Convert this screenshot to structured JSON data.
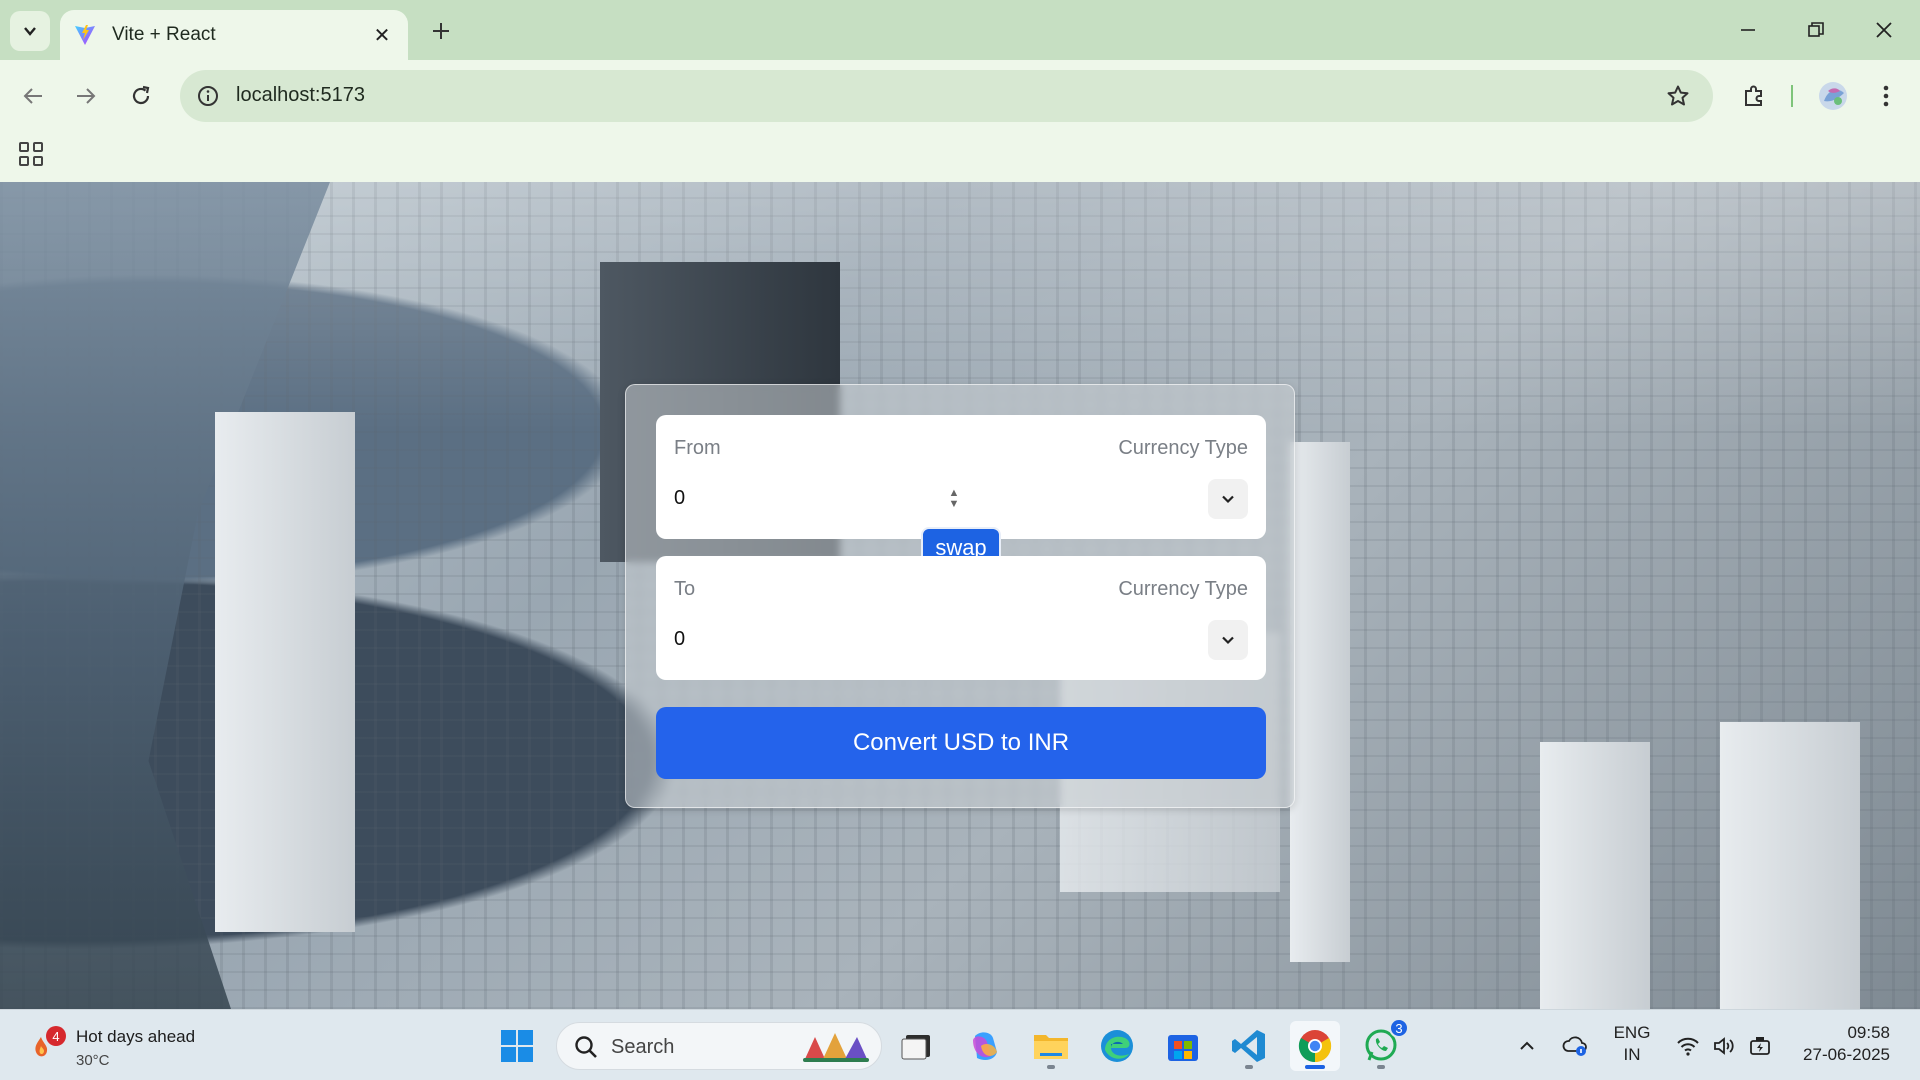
{
  "browser": {
    "tab_title": "Vite + React",
    "url": "localhost:5173"
  },
  "converter": {
    "from": {
      "label": "From",
      "currency_type_label": "Currency Type",
      "amount": "0"
    },
    "to": {
      "label": "To",
      "currency_type_label": "Currency Type",
      "amount": "0"
    },
    "swap_label": "swap",
    "convert_label": "Convert USD to INR",
    "accent_color": "#2463eb"
  },
  "taskbar": {
    "weather": {
      "title": "Hot days ahead",
      "temperature": "30°C",
      "alert_count": "4"
    },
    "search_placeholder": "Search",
    "whatsapp_badge": "3",
    "language": {
      "line1": "ENG",
      "line2": "IN"
    },
    "clock": {
      "time": "09:58",
      "date": "27-06-2025"
    }
  }
}
